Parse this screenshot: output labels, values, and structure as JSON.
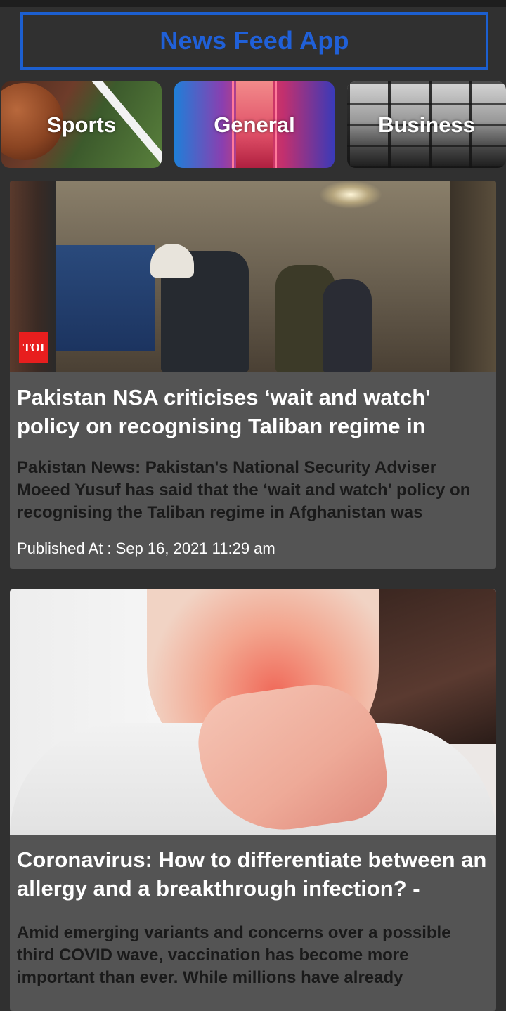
{
  "header": {
    "title": "News Feed App"
  },
  "categories": [
    {
      "label": "Sports"
    },
    {
      "label": "General"
    },
    {
      "label": "Business"
    }
  ],
  "articles": [
    {
      "title": "Pakistan NSA criticises ‘wait and watch' policy on recognising Taliban regime in",
      "description": "Pakistan News: Pakistan's National Security Adviser Moeed Yusuf has said that the ‘wait and watch' policy on recognising the Taliban regime in Afghanistan was",
      "published": "Published At : Sep 16, 2021 11:29 am",
      "source_badge": "TOI"
    },
    {
      "title": "Coronavirus: How to differentiate between an allergy and a breakthrough infection? -",
      "description": "Amid emerging variants and concerns over a possible third COVID wave, vaccination has become more important than ever. While millions have already"
    }
  ],
  "colors": {
    "background": "#303030",
    "card": "#545454",
    "accent": "#1c5fd0",
    "badge": "#e81e1e"
  }
}
